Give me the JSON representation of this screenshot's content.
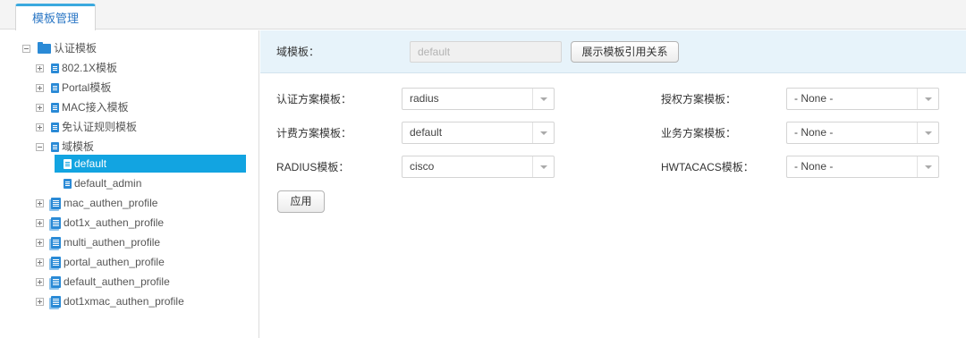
{
  "tab": {
    "label": "模板管理"
  },
  "tree": {
    "root": "认证模板",
    "items": [
      {
        "label": "802.1X模板"
      },
      {
        "label": "Portal模板"
      },
      {
        "label": "MAC接入模板"
      },
      {
        "label": "免认证规则模板"
      },
      {
        "label": "域模板"
      },
      {
        "label": "default",
        "selected": true
      },
      {
        "label": "default_admin"
      },
      {
        "label": "mac_authen_profile"
      },
      {
        "label": "dot1x_authen_profile"
      },
      {
        "label": "multi_authen_profile"
      },
      {
        "label": "portal_authen_profile"
      },
      {
        "label": "default_authen_profile"
      },
      {
        "label": "dot1xmac_authen_profile"
      }
    ]
  },
  "domain": {
    "label": "域模板：",
    "value": "default",
    "show_relation_button": "展示模板引用关系"
  },
  "form": {
    "authentication_scheme": {
      "label": "认证方案模板：",
      "value": "radius"
    },
    "authorization_scheme": {
      "label": "授权方案模板：",
      "value": "- None -"
    },
    "accounting_scheme": {
      "label": "计费方案模板：",
      "value": "default"
    },
    "service_scheme": {
      "label": "业务方案模板：",
      "value": "- None -"
    },
    "radius_template": {
      "label": "RADIUS模板：",
      "value": "cisco"
    },
    "hwtacacs_template": {
      "label": "HWTACACS模板：",
      "value": "- None -"
    },
    "apply_button": "应用"
  },
  "colors": {
    "accent": "#12a4e1",
    "panel": "#e7f3fa",
    "icon": "#2a8ad6"
  }
}
